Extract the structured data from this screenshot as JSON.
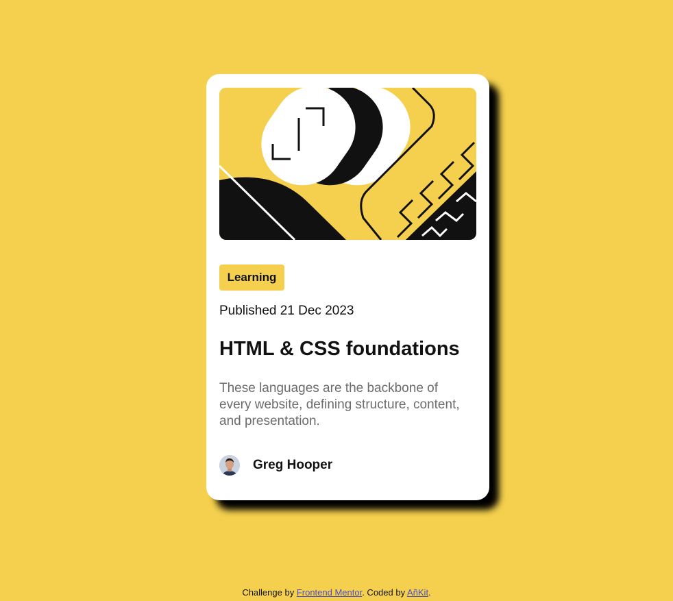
{
  "colors": {
    "background": "#f4d04e",
    "card": "#ffffff",
    "text": "#111111",
    "muted": "#6b6b6b",
    "link": "#4a4fc4"
  },
  "card": {
    "hero_icon": "abstract-illustration",
    "tag": "Learning",
    "published": "Published 21 Dec 2023",
    "title": "HTML & CSS foundations",
    "description": "These languages are the backbone of every website, defining structure, content, and presentation.",
    "author": {
      "avatar_icon": "avatar-photo",
      "name": "Greg Hooper"
    }
  },
  "footer": {
    "prefix": "Challenge by ",
    "link1": "Frontend Mentor",
    "middle": ". Coded by ",
    "link2": "AñKit",
    "suffix": "."
  }
}
